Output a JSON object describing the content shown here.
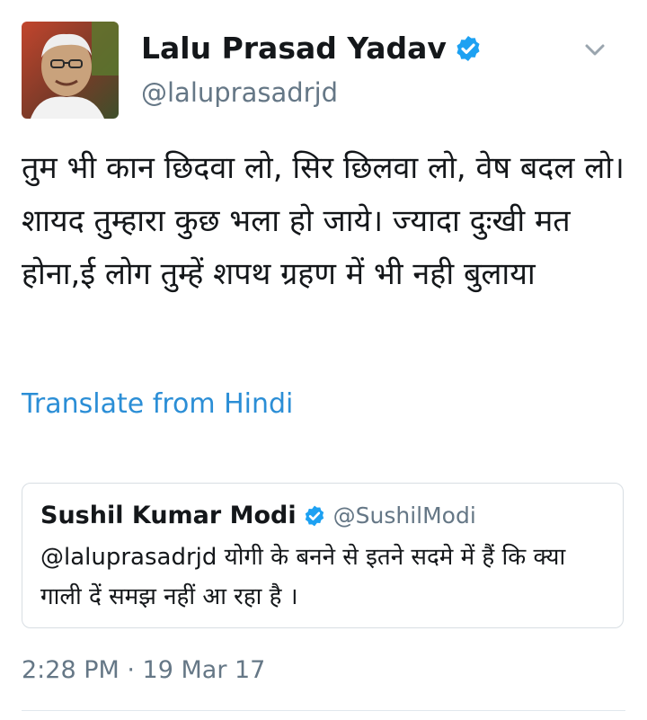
{
  "tweet": {
    "author_name": "Lalu Prasad Yadav",
    "author_handle": "@laluprasadrjd",
    "text": "तुम भी कान छिदवा लो, सिर छिलवा लो, वेष बदल लो।शायद तुम्हारा कुछ भला हो जाये। ज्यादा दुःखी मत होना,ई लोग तुम्हें शपथ ग्रहण में भी नही बुलाया",
    "translate_label": "Translate from Hindi",
    "timestamp": "2:28 PM · 19 Mar 17"
  },
  "quoted_tweet": {
    "author_name": "Sushil Kumar Modi",
    "author_handle": "@SushilModi",
    "text": "@laluprasadrjd योगी के बनने से इतने सदमे में हैं कि क्या गाली दें समझ नहीं आ रहा है ।"
  },
  "icons": {
    "verified": "verified-badge-icon",
    "menu": "chevron-down-icon"
  },
  "colors": {
    "verified": "#1da1f2",
    "link": "#2b8ed6",
    "secondary_text": "#657786",
    "border": "#d8dee3"
  }
}
